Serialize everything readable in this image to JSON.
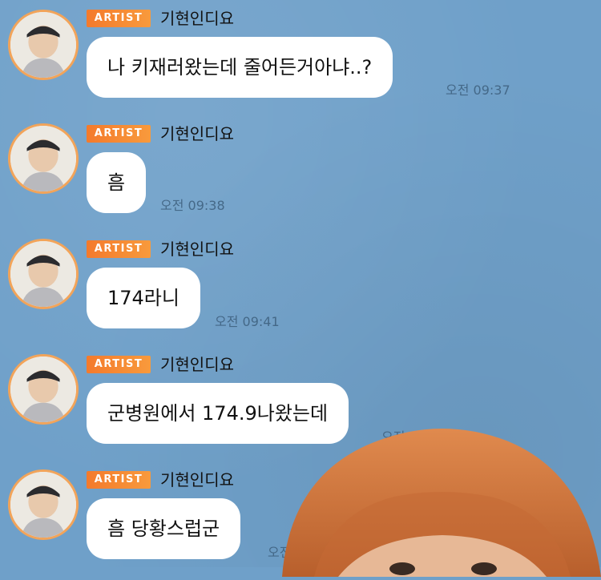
{
  "messages": [
    {
      "badge": "ARTIST",
      "sender": "기현인디요",
      "text": "나 키재러왔는데 줄어든거아냐..?",
      "time": "오전 09:37"
    },
    {
      "badge": "ARTIST",
      "sender": "기현인디요",
      "text": "흠",
      "time": "오전 09:38"
    },
    {
      "badge": "ARTIST",
      "sender": "기현인디요",
      "text": "174라니",
      "time": "오전 09:41"
    },
    {
      "badge": "ARTIST",
      "sender": "기현인디요",
      "text": "군병원에서 174.9나왔는데",
      "time": "오전 09:41"
    },
    {
      "badge": "ARTIST",
      "sender": "기현인디요",
      "text": "흠 당황스럽군",
      "time": "오전 09:41"
    }
  ],
  "colors": {
    "background": "#6fa0c9",
    "badge": "#f47a2c",
    "bubble": "#ffffff",
    "avatar_ring": "#f2a45a"
  },
  "icons": {
    "avatar": "profile-photo",
    "overlay": "person-peeking-photo"
  }
}
